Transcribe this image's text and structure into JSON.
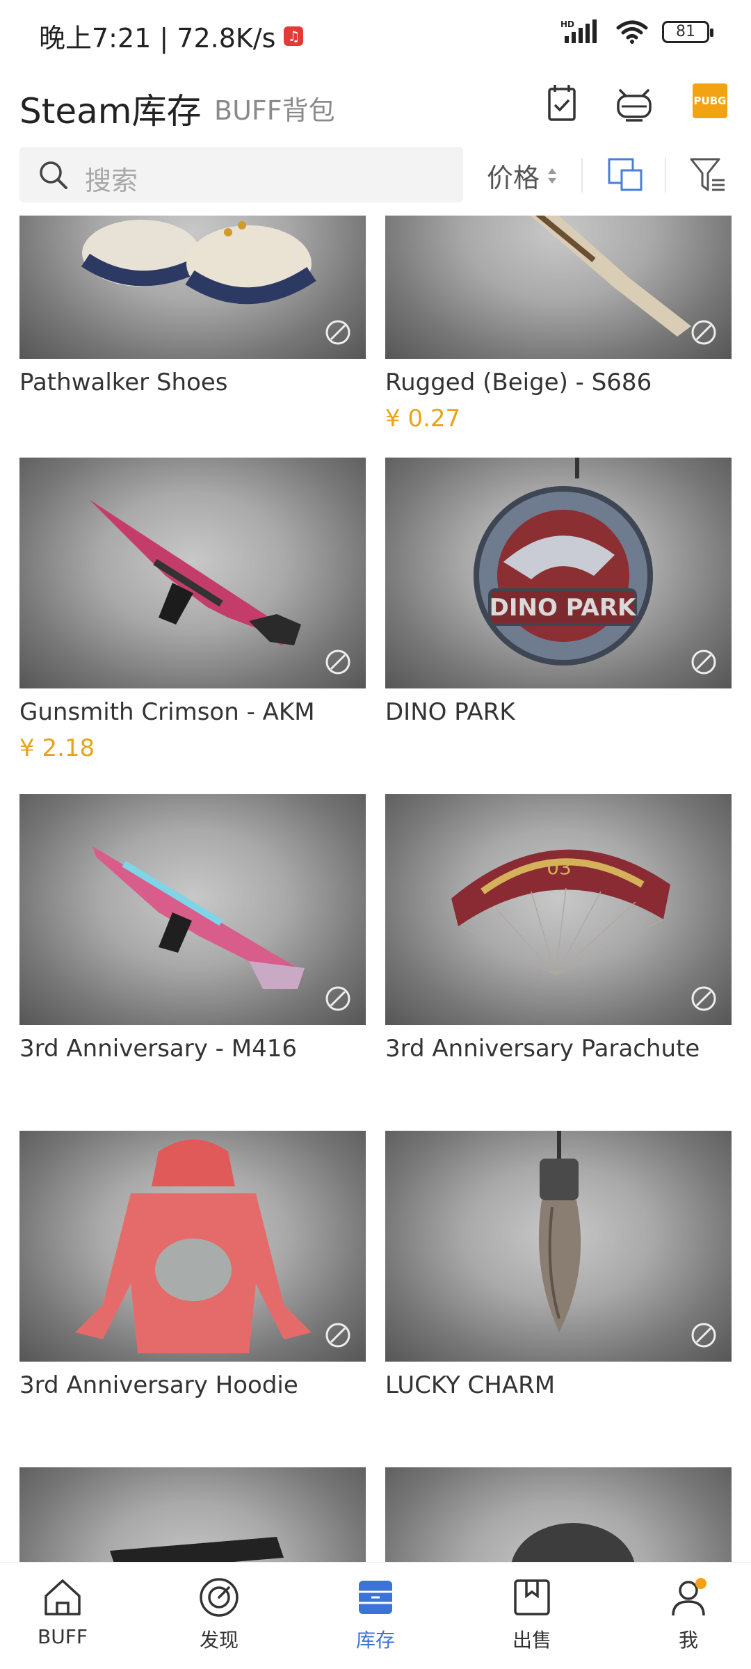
{
  "status_bar": {
    "time_speed": "晚上7:21 | 72.8K/s",
    "network": "HD",
    "battery": "81"
  },
  "header": {
    "tab_active": "Steam库存",
    "tab_inactive": "BUFF背包",
    "game_badge": "PUBG"
  },
  "search": {
    "placeholder": "搜索",
    "sort_label": "价格"
  },
  "items": [
    {
      "name": "Pathwalker Shoes",
      "price": ""
    },
    {
      "name": "Rugged (Beige) - S686",
      "price": "¥ 0.27"
    },
    {
      "name": "Gunsmith Crimson - AKM",
      "price": "¥ 2.18"
    },
    {
      "name": "DINO PARK",
      "price": ""
    },
    {
      "name": "3rd Anniversary - M416",
      "price": ""
    },
    {
      "name": "3rd Anniversary Parachute",
      "price": ""
    },
    {
      "name": "3rd Anniversary Hoodie",
      "price": ""
    },
    {
      "name": "LUCKY CHARM",
      "price": ""
    },
    {
      "name": "",
      "price": ""
    },
    {
      "name": "",
      "price": ""
    }
  ],
  "item_art": {
    "dino_text": "DINO PARK",
    "parachute_text": "03"
  },
  "nav": [
    {
      "label": "BUFF",
      "icon": "home-icon"
    },
    {
      "label": "发现",
      "icon": "discover-icon"
    },
    {
      "label": "库存",
      "icon": "inventory-icon"
    },
    {
      "label": "出售",
      "icon": "sell-box-icon"
    },
    {
      "label": "我",
      "icon": "user-icon"
    }
  ],
  "colors": {
    "accent": "#3b73d6",
    "price": "#e8a317",
    "badge": "#f2a314"
  }
}
